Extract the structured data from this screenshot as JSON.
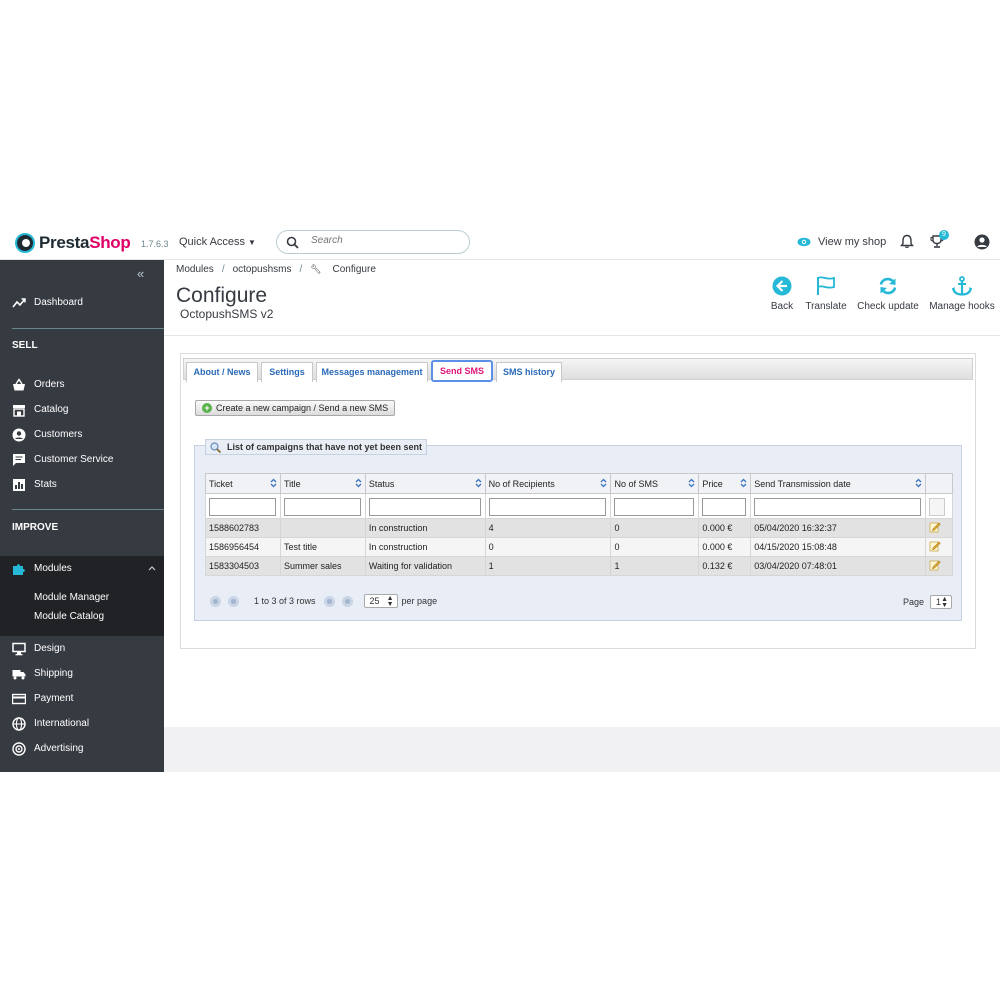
{
  "header": {
    "logo_pre": "Presta",
    "logo_shop": "Shop",
    "version": "1.7.6.3",
    "quick_access": "Quick Access",
    "search_placeholder": "Search",
    "view_shop": "View my shop",
    "notification_count": "9"
  },
  "sidebar": {
    "dashboard": "Dashboard",
    "sell_section": "SELL",
    "sell_items": [
      "Orders",
      "Catalog",
      "Customers",
      "Customer Service",
      "Stats"
    ],
    "improve_section": "IMPROVE",
    "modules": "Modules",
    "modules_sub": [
      "Module Manager",
      "Module Catalog"
    ],
    "improve_items": [
      "Design",
      "Shipping",
      "Payment",
      "International",
      "Advertising"
    ]
  },
  "toolbar": {
    "breadcrumb": [
      "Modules",
      "octopushsms",
      "Configure"
    ],
    "title": "Configure",
    "subtitle": "OctopushSMS v2",
    "buttons": {
      "back": "Back",
      "translate": "Translate",
      "check_update": "Check update",
      "manage_hooks": "Manage hooks"
    }
  },
  "tabs": [
    "About / News",
    "Settings",
    "Messages management",
    "Send SMS",
    "SMS history"
  ],
  "active_tab": "Send SMS",
  "create_button": "Create a new campaign / Send a new SMS",
  "list": {
    "legend": "List of campaigns that have not yet been sent",
    "columns": [
      "Ticket",
      "Title",
      "Status",
      "No of Recipients",
      "No of SMS",
      "Price",
      "Send Transmission date"
    ],
    "rows": [
      {
        "ticket": "1588602783",
        "title": "",
        "status": "In construction",
        "recipients": "4",
        "sms": "0",
        "price": "0.000 €",
        "date": "05/04/2020 16:32:37"
      },
      {
        "ticket": "1586956454",
        "title": "Test title",
        "status": "In construction",
        "recipients": "0",
        "sms": "0",
        "price": "0.000 €",
        "date": "04/15/2020 15:08:48"
      },
      {
        "ticket": "1583304503",
        "title": "Summer sales",
        "status": "Waiting for validation",
        "recipients": "1",
        "sms": "1",
        "price": "0.132 €",
        "date": "03/04/2020 07:48:01"
      }
    ],
    "pager": {
      "rows_text": "1 to 3 of 3 rows",
      "per_page_value": "25",
      "per_page_label": "per page",
      "page_label": "Page",
      "page_value": "1"
    }
  },
  "colors": {
    "sidebar_bg": "#363a41",
    "sidebar_active": "#202226",
    "accent": "#25b9d7",
    "brand_pink": "#df0067",
    "active_tab_text": "#e0157a"
  }
}
